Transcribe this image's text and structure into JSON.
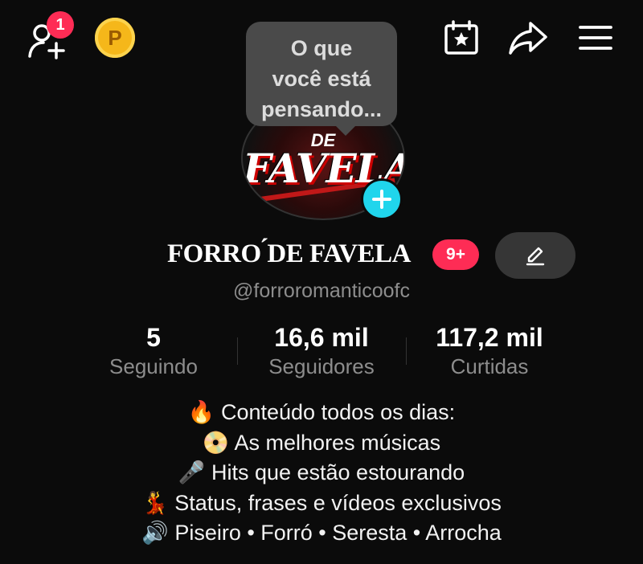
{
  "topbar": {
    "add_friend_badge": "1",
    "coin_label": "P"
  },
  "avatar": {
    "logo_line1": "DE",
    "logo_line2": "FAVELA"
  },
  "tooltip": {
    "text_line1": "O que",
    "text_line2": "você está",
    "text_line3": "pensando..."
  },
  "profile": {
    "name": "FORRO ́DE FAVELA",
    "notification_badge": "9+",
    "handle": "@forroromanticoofc"
  },
  "stats": [
    {
      "value": "5",
      "label": "Seguindo"
    },
    {
      "value": "16,6 mil",
      "label": "Seguidores"
    },
    {
      "value": "117,2 mil",
      "label": "Curtidas"
    }
  ],
  "bio": [
    {
      "emoji": "🔥",
      "text": "Conteúdo todos os dias:"
    },
    {
      "emoji": "📀",
      "text": "As melhores músicas"
    },
    {
      "emoji": "🎤",
      "text": "Hits que estão estourando"
    },
    {
      "emoji": "💃",
      "text": "Status, frases e vídeos exclusivos"
    },
    {
      "emoji": "🔊",
      "text": "Piseiro • Forró • Seresta • Arrocha"
    }
  ],
  "colors": {
    "background": "#0b0b0b",
    "accent_red": "#fe2c55",
    "accent_cyan": "#20d5ec",
    "muted_text": "#8d8d8d"
  }
}
